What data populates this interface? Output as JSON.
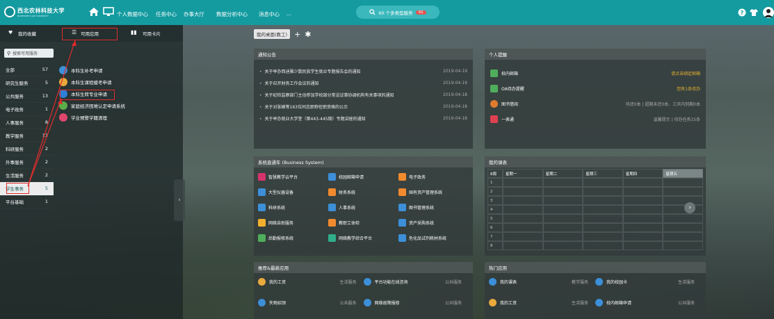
{
  "header": {
    "logo_cn": "西北农林科技大学",
    "logo_en": "NORTHWEST A&F UNIVERSITY",
    "nav": [
      "个人数据中心",
      "任务中心",
      "办事大厅",
      "数据分析中心",
      "消息中心",
      "..."
    ],
    "search_text": "60 个多类型服务",
    "search_badge": "41"
  },
  "sidebar": {
    "tabs": [
      "我的收藏",
      "可用应用",
      "可用卡片"
    ],
    "search_placeholder": "搜索可用服务",
    "categories": [
      {
        "name": "全部",
        "count": "57"
      },
      {
        "name": "研究生服务",
        "count": "5"
      },
      {
        "name": "公共服务",
        "count": "13"
      },
      {
        "name": "电子政务",
        "count": "1"
      },
      {
        "name": "人事服务",
        "count": "8"
      },
      {
        "name": "教学服务",
        "count": "13"
      },
      {
        "name": "科研服务",
        "count": "2"
      },
      {
        "name": "外事服务",
        "count": "2"
      },
      {
        "name": "生活服务",
        "count": "2"
      },
      {
        "name": "学生事务",
        "count": "5"
      },
      {
        "name": "平台基础",
        "count": "1"
      }
    ],
    "apps": [
      {
        "label": "本科生补考申请",
        "color": "#3c8fd8"
      },
      {
        "label": "本科生课程缓考申请",
        "color": "#e9a93c"
      },
      {
        "label": "本科生转专业申请",
        "color": "#2f7ed8"
      },
      {
        "label": "家庭经济困难认定申请系统",
        "color": "#5aae4a"
      },
      {
        "label": "学业预警学籍清理",
        "color": "#e0466d"
      }
    ]
  },
  "main": {
    "tabs": [
      "我的桌面(教工)"
    ],
    "notice": {
      "title": "通知公告",
      "items": [
        {
          "text": "关于举办西迪雅少数民族学生就业专题报告会的通知",
          "date": "2019-04-19"
        },
        {
          "text": "关于召开财务工作会议的通知",
          "date": "2019-04-19"
        },
        {
          "text": "关于纪检监察部门主动参加学校部分常设议事协调机构有关事项的通知",
          "date": "2019-04-18"
        },
        {
          "text": "关于对张峰等163位同志职称任职资格的公示",
          "date": "2019-04-18"
        },
        {
          "text": "关于举办就业大学堂（第443-445期）专题讲座的通知",
          "date": "2019-04-18"
        }
      ]
    },
    "remind": {
      "title": "个人提醒",
      "items": [
        {
          "label": "校内邮箱",
          "right": "请点击绑定邮箱",
          "color": "#4fae5b"
        },
        {
          "label": "OA待办提醒",
          "right": "您有1条待办",
          "color": "#4fae5b"
        },
        {
          "label": "图书借阅",
          "right": "待还0本 | 超期未还0本、三天内到期0本",
          "color": "#e07a2e"
        },
        {
          "label": "一表通",
          "right": "温馨提示 | 待办任务15条",
          "color": "#e04050"
        }
      ]
    },
    "business": {
      "title": "系统直通车 (Business System)",
      "items": [
        {
          "label": "智慧教学云平台",
          "color": "#d6336c"
        },
        {
          "label": "校园邮箱申请",
          "color": "#3c8fd8"
        },
        {
          "label": "电子政务",
          "color": "#f28a2e"
        },
        {
          "label": "大型仪器设备",
          "color": "#3c8fd8"
        },
        {
          "label": "财务系统",
          "color": "#f28a2e"
        },
        {
          "label": "国有资产管理系统",
          "color": "#f28a2e"
        },
        {
          "label": "科研系统",
          "color": "#3c8fd8"
        },
        {
          "label": "人事系统",
          "color": "#3c8fd8"
        },
        {
          "label": "图书管理系统",
          "color": "#3c8fd8"
        },
        {
          "label": "网络自助服务",
          "color": "#f2b02e"
        },
        {
          "label": "教职工体检",
          "color": "#f28a2e"
        },
        {
          "label": "资产采购系统",
          "color": "#3c8fd8"
        },
        {
          "label": "后勤报修系统",
          "color": "#4fae5b"
        },
        {
          "label": "网络教学综合平台",
          "color": "#2fae8a"
        },
        {
          "label": "危化品试剂耗材系统",
          "color": "#3c8fd8"
        }
      ]
    },
    "course": {
      "title": "我的课表",
      "week": "8周",
      "days": [
        "星期一",
        "星期二",
        "星期三",
        "星期四",
        "星期五"
      ],
      "periods": [
        "1",
        "2",
        "3",
        "4",
        "5",
        "6",
        "7",
        "8"
      ]
    },
    "recommend": {
      "title": "推荐&最新应用",
      "items": [
        {
          "label": "我的工资",
          "tag": "生活服务",
          "color": "#e9a93c"
        },
        {
          "label": "平台功能在线咨询",
          "tag": "公共服务",
          "color": "#3c8fd8"
        },
        {
          "label": "失物招领",
          "tag": "公共服务",
          "color": "#3c8fd8"
        },
        {
          "label": "网络故障报修",
          "tag": "公共服务",
          "color": "#3c8fd8"
        }
      ]
    },
    "hot": {
      "title": "热门应用",
      "items": [
        {
          "label": "我的课表",
          "tag": "教学服务",
          "color": "#3c8fd8"
        },
        {
          "label": "我的校园卡",
          "tag": "生活服务",
          "color": "#3c8fd8"
        },
        {
          "label": "我的工资",
          "tag": "生活服务",
          "color": "#e9a93c"
        },
        {
          "label": "校内邮箱申请",
          "tag": "公共服务",
          "color": "#3c8fd8"
        }
      ]
    }
  }
}
